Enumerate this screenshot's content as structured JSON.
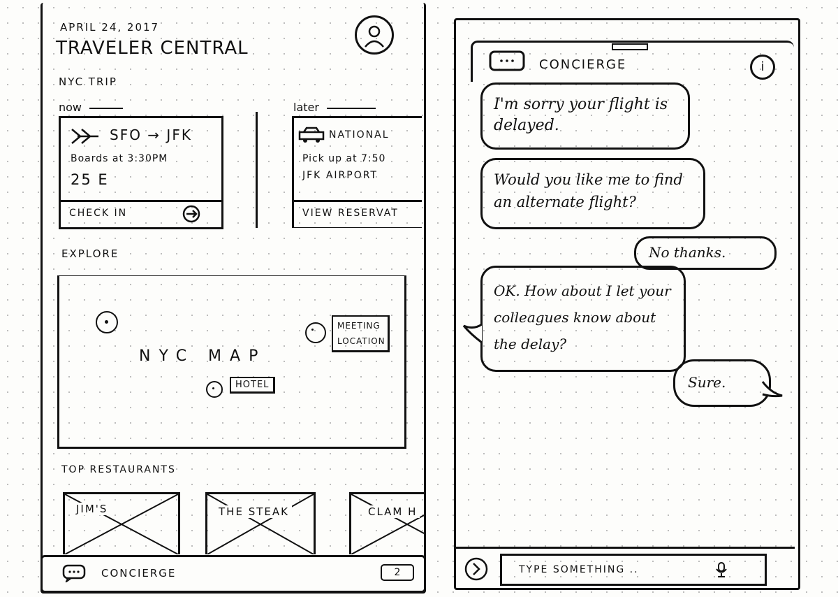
{
  "left": {
    "date": "APRIL 24, 2017",
    "title": "TRAVELER CENTRAL",
    "trip_label": "NYC TRIP",
    "now_label": "now",
    "later_label": "later",
    "flight_card": {
      "route": "SFO → JFK",
      "boards": "Boards at 3:30PM",
      "seat": "25 E",
      "action": "CHECK IN"
    },
    "car_card": {
      "name": "NATIONAL",
      "pickup": "Pick up at 7:50",
      "location": "JFK AIRPORT",
      "action": "VIEW RESERVAT"
    },
    "explore_label": "EXPLORE",
    "map": {
      "label": "NYC MAP",
      "meeting_tag": "MEETING LOCATION",
      "hotel_tag": "HOTEL"
    },
    "restaurants_label": "TOP RESTAURANTS",
    "restaurants": [
      "JIM'S",
      "THE STEAK",
      "CLAM H"
    ],
    "concierge_bar": {
      "label": "CONCIERGE",
      "badge": "2"
    }
  },
  "right": {
    "header_title": "CONCIERGE",
    "info_icon": "i",
    "messages": [
      {
        "from": "bot",
        "text": "I'm sorry your flight is delayed."
      },
      {
        "from": "bot",
        "text": "Would you like me to find an alternate flight?"
      },
      {
        "from": "user",
        "text": "No thanks."
      },
      {
        "from": "bot",
        "text": "OK. How about I let your colleagues know about the delay?"
      },
      {
        "from": "user",
        "text": "Sure."
      }
    ],
    "input_placeholder": "TYPE SOMETHING .."
  }
}
